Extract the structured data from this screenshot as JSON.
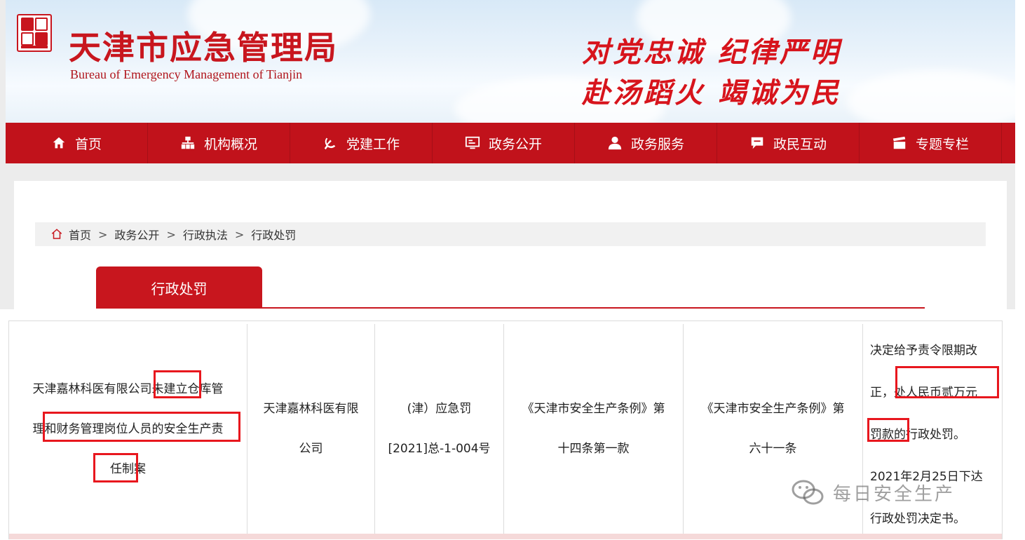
{
  "header": {
    "site_title": "天津市应急管理局",
    "site_subtitle": "Bureau  of  Emergency  Management  of  Tianjin",
    "motto_line1": "对党忠诚  纪律严明",
    "motto_line2": "赴汤蹈火  竭诚为民"
  },
  "nav": {
    "items": [
      {
        "label": "首页",
        "icon": "home-icon"
      },
      {
        "label": "机构概况",
        "icon": "org-chart-icon"
      },
      {
        "label": "党建工作",
        "icon": "party-emblem-icon"
      },
      {
        "label": "政务公开",
        "icon": "monitor-icon"
      },
      {
        "label": "政务服务",
        "icon": "user-icon"
      },
      {
        "label": "政民互动",
        "icon": "chat-icon"
      },
      {
        "label": "专题专栏",
        "icon": "clapper-icon"
      }
    ]
  },
  "breadcrumb": {
    "home": "首页",
    "sep": ">",
    "level1": "政务公开",
    "level2": "行政执法",
    "level3": "行政处罚"
  },
  "tab": {
    "label": "行政处罚"
  },
  "table": {
    "row": {
      "case_line1": "天津嘉林科医有限公司未建立仓库管",
      "case_line2": "理和财务管理岗位人员的安全生产责",
      "case_line3": "任制案",
      "party_line1": "天津嘉林科医有限",
      "party_line2": "公司",
      "doc_no_line1": "(津）应急罚",
      "doc_no_line2": "[2021]总-1-004号",
      "basis_line1": "《天津市安全生产条例》第",
      "basis_line2": "十四条第一款",
      "penalty_basis_line1": "《天津市安全生产条例》第",
      "penalty_basis_line2": "六十一条",
      "decision_line1": "决定给予责令限期改",
      "decision_line2": "正，处人民币贰万元",
      "decision_line3": "罚款的行政处罚。",
      "decision_line4": "2021年2月25日下达",
      "decision_line5": "行政处罚决定书。"
    }
  },
  "watermark": {
    "text": "每日安全生产"
  },
  "colors": {
    "brand_red": "#c1121b",
    "highlight": "#e8171e",
    "banner_sky": "#d8e9f7"
  }
}
